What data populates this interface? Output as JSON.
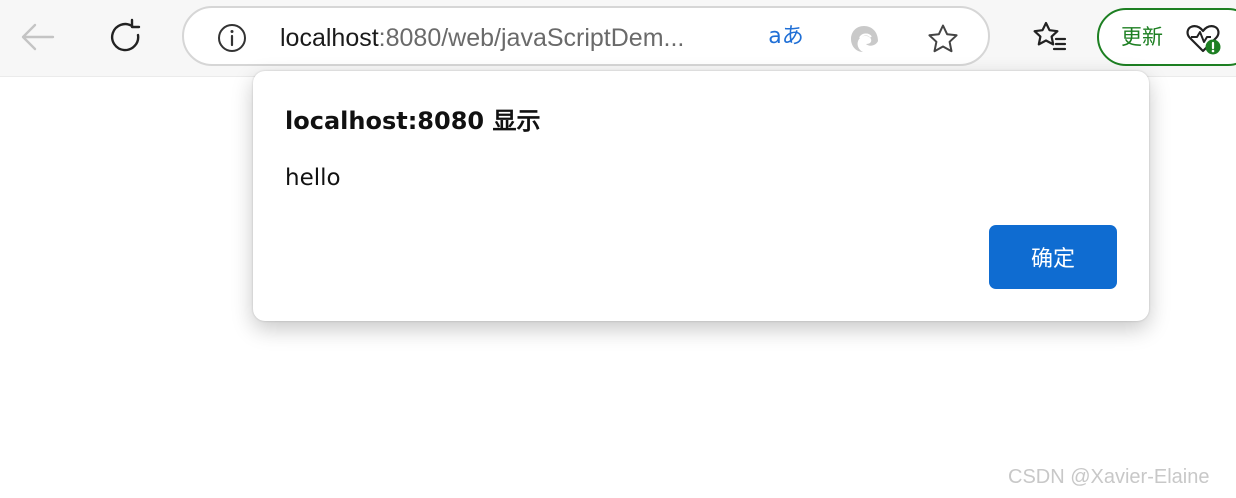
{
  "browser": {
    "address_bar": {
      "url_host": "localhost",
      "url_rest": ":8080/web/javaScriptDem..."
    },
    "translate_icon_text": "aあ",
    "update_button_label": "更新",
    "icons": {
      "back": "back-arrow-icon",
      "refresh": "refresh-icon",
      "info": "info-icon",
      "translate": "translate-icon",
      "edge": "edge-icon",
      "favorite": "star-icon",
      "favorites_list": "favorites-icon",
      "health": "browser-essentials-icon"
    },
    "colors": {
      "update_green": "#1d7f22",
      "accent_blue": "#0f6cd1"
    }
  },
  "dialog": {
    "title": "localhost:8080 显示",
    "message": "hello",
    "ok_label": "确定"
  },
  "watermark": "CSDN @Xavier-Elaine"
}
